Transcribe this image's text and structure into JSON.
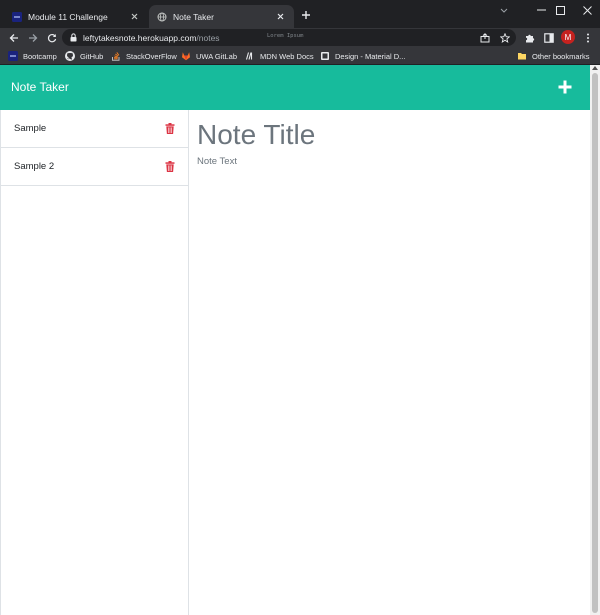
{
  "browser": {
    "tabs": [
      {
        "title": "Module 11 Challenge",
        "active": false,
        "favicon": "bootcamp-logo-icon"
      },
      {
        "title": "Note Taker",
        "active": true,
        "favicon": "globe-icon"
      }
    ],
    "url_host": "leftytakesnote.herokuapp.com",
    "url_path": "/notes",
    "omnibox_extension_text": "Lorem Ipsum",
    "profile_initial": "M",
    "bookmarks": [
      {
        "label": "Bootcamp",
        "icon": "bootcamp-logo-icon"
      },
      {
        "label": "GitHub",
        "icon": "github-icon"
      },
      {
        "label": "StackOverFlow",
        "icon": "stackoverflow-icon"
      },
      {
        "label": "UWA GitLab",
        "icon": "gitlab-icon"
      },
      {
        "label": "MDN Web Docs",
        "icon": "mdn-icon"
      },
      {
        "label": "Design - Material D...",
        "icon": "material-design-icon"
      }
    ],
    "other_bookmarks": "Other bookmarks"
  },
  "app": {
    "brand": "Note Taker",
    "notes": [
      {
        "title": "Sample"
      },
      {
        "title": "Sample 2"
      }
    ],
    "editor": {
      "title_placeholder": "Note Title",
      "text_placeholder": "Note Text"
    }
  },
  "colors": {
    "navbar": "#17bb9c",
    "delete_icon": "#dc3545",
    "chrome_dark": "#202124",
    "chrome_toolbar": "#35363a",
    "avatar": "#c5221f"
  }
}
